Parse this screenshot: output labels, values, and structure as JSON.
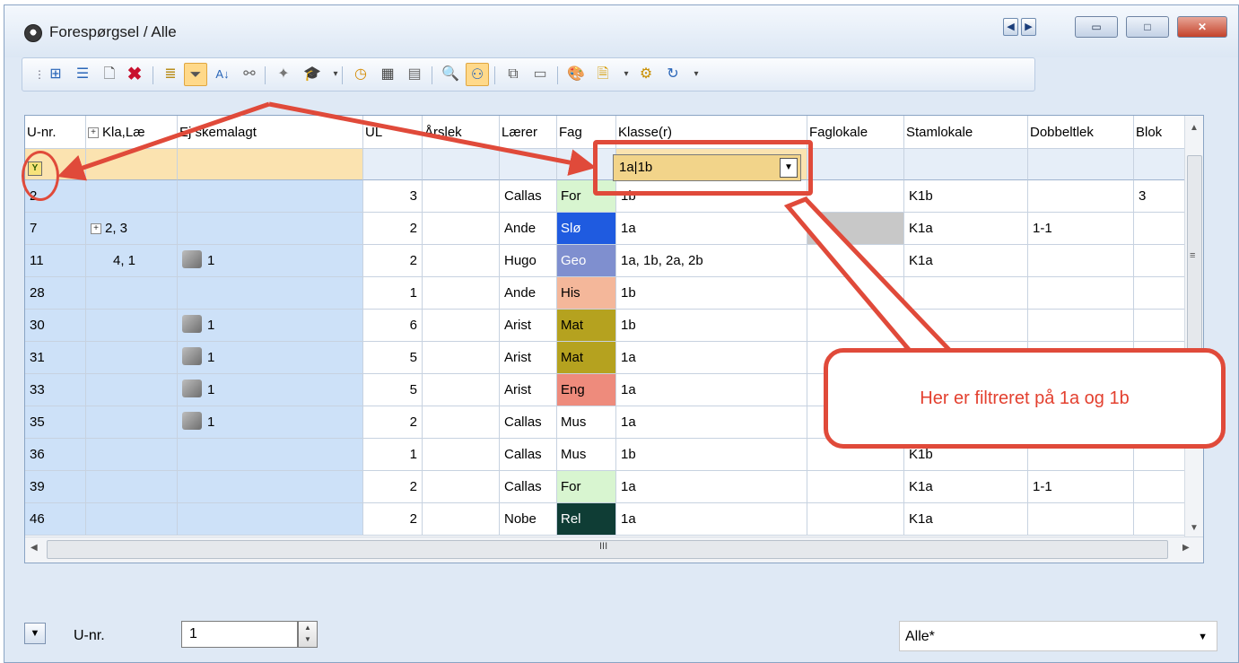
{
  "window": {
    "title": "Forespørgsel / Alle",
    "nav_prev": "◀",
    "nav_next": "▶",
    "minimize": "▭",
    "maximize": "□",
    "close": "✕"
  },
  "toolbar": {
    "icons": [
      "add-row-icon",
      "list-icon",
      "new-doc-icon",
      "delete-icon",
      "report-icon",
      "filter-icon",
      "sort-icon",
      "link-icon",
      "wand-icon",
      "teacher-icon",
      "clock-icon",
      "calendar-icon",
      "timetable-icon",
      "search-icon",
      "people-icon",
      "copy-icon",
      "chat-icon",
      "palette-icon",
      "document-icon",
      "settings-gear-icon",
      "refresh-icon"
    ]
  },
  "grid": {
    "columns": [
      "U-nr.",
      "Kla,Læ",
      "Ej skemalagt",
      "UL",
      "Årslek",
      "Lærer",
      "Fag",
      "Klasse(r)",
      "Faglokale",
      "Stamlokale",
      "Dobbeltlek",
      "Blok"
    ],
    "filter": {
      "klasse_value": "1a|1b",
      "filter_icon": "Y"
    },
    "rows": [
      {
        "unr": "2",
        "kla": "",
        "ej": "",
        "ul": "3",
        "aarslek": "",
        "laerer": "Callas",
        "fag": "For",
        "fag_bg": "#d8f5d0",
        "fag_fg": "#000000",
        "klasse": "1b",
        "faglokale": "",
        "stamlokale": "K1b",
        "dobbelt": "",
        "blok": "3",
        "hand": false,
        "expand": false
      },
      {
        "unr": "7",
        "kla": "2, 3",
        "ej": "",
        "ul": "2",
        "aarslek": "",
        "laerer": "Ande",
        "fag": "Slø",
        "fag_bg": "#1f5be0",
        "fag_fg": "#ffffff",
        "klasse": "1a",
        "faglokale": "",
        "stamlokale": "K1a",
        "dobbelt": "1-1",
        "blok": "",
        "hand": false,
        "expand": true
      },
      {
        "unr": "11",
        "kla": "4, 1",
        "ej": "1",
        "ul": "2",
        "aarslek": "",
        "laerer": "Hugo",
        "fag": "Geo",
        "fag_bg": "#7f8fcf",
        "fag_fg": "#ffffff",
        "klasse": "1a, 1b, 2a, 2b",
        "faglokale": "",
        "stamlokale": "K1a",
        "dobbelt": "",
        "blok": "",
        "hand": true,
        "expand": false
      },
      {
        "unr": "28",
        "kla": "",
        "ej": "",
        "ul": "1",
        "aarslek": "",
        "laerer": "Ande",
        "fag": "His",
        "fag_bg": "#f4b79a",
        "fag_fg": "#000000",
        "klasse": "1b",
        "faglokale": "",
        "stamlokale": "",
        "dobbelt": "",
        "blok": "",
        "hand": false,
        "expand": false
      },
      {
        "unr": "30",
        "kla": "",
        "ej": "1",
        "ul": "6",
        "aarslek": "",
        "laerer": "Arist",
        "fag": "Mat",
        "fag_bg": "#b5a21f",
        "fag_fg": "#000000",
        "klasse": "1b",
        "faglokale": "",
        "stamlokale": "",
        "dobbelt": "",
        "blok": "",
        "hand": true,
        "expand": false
      },
      {
        "unr": "31",
        "kla": "",
        "ej": "1",
        "ul": "5",
        "aarslek": "",
        "laerer": "Arist",
        "fag": "Mat",
        "fag_bg": "#b5a21f",
        "fag_fg": "#000000",
        "klasse": "1a",
        "faglokale": "",
        "stamlokale": "",
        "dobbelt": "",
        "blok": "",
        "hand": true,
        "expand": false
      },
      {
        "unr": "33",
        "kla": "",
        "ej": "1",
        "ul": "5",
        "aarslek": "",
        "laerer": "Arist",
        "fag": "Eng",
        "fag_bg": "#ee8b7c",
        "fag_fg": "#000000",
        "klasse": "1a",
        "faglokale": "",
        "stamlokale": "",
        "dobbelt": "",
        "blok": "",
        "hand": true,
        "expand": false
      },
      {
        "unr": "35",
        "kla": "",
        "ej": "1",
        "ul": "2",
        "aarslek": "",
        "laerer": "Callas",
        "fag": "Mus",
        "fag_bg": "#ffffff",
        "fag_fg": "#000000",
        "klasse": "1a",
        "faglokale": "",
        "stamlokale": "",
        "dobbelt": "",
        "blok": "",
        "hand": true,
        "expand": false
      },
      {
        "unr": "36",
        "kla": "",
        "ej": "",
        "ul": "1",
        "aarslek": "",
        "laerer": "Callas",
        "fag": "Mus",
        "fag_bg": "#ffffff",
        "fag_fg": "#000000",
        "klasse": "1b",
        "faglokale": "",
        "stamlokale": "K1b",
        "dobbelt": "",
        "blok": "",
        "hand": false,
        "expand": false
      },
      {
        "unr": "39",
        "kla": "",
        "ej": "",
        "ul": "2",
        "aarslek": "",
        "laerer": "Callas",
        "fag": "For",
        "fag_bg": "#d8f5d0",
        "fag_fg": "#000000",
        "klasse": "1a",
        "faglokale": "",
        "stamlokale": "K1a",
        "dobbelt": "1-1",
        "blok": "",
        "hand": false,
        "expand": false
      },
      {
        "unr": "46",
        "kla": "",
        "ej": "",
        "ul": "2",
        "aarslek": "",
        "laerer": "Nobe",
        "fag": "Rel",
        "fag_bg": "#0f3d35",
        "fag_fg": "#ffffff",
        "klasse": "1a",
        "faglokale": "",
        "stamlokale": "K1a",
        "dobbelt": "",
        "blok": "",
        "hand": false,
        "expand": false
      }
    ],
    "scroll_marker": "III"
  },
  "statusbar": {
    "field_label": "U-nr.",
    "field_value": "1",
    "view_select": "Alle*"
  },
  "annotation": {
    "callout_text": "Her er filtreret på 1a og 1b",
    "color": "#e04a3a"
  }
}
